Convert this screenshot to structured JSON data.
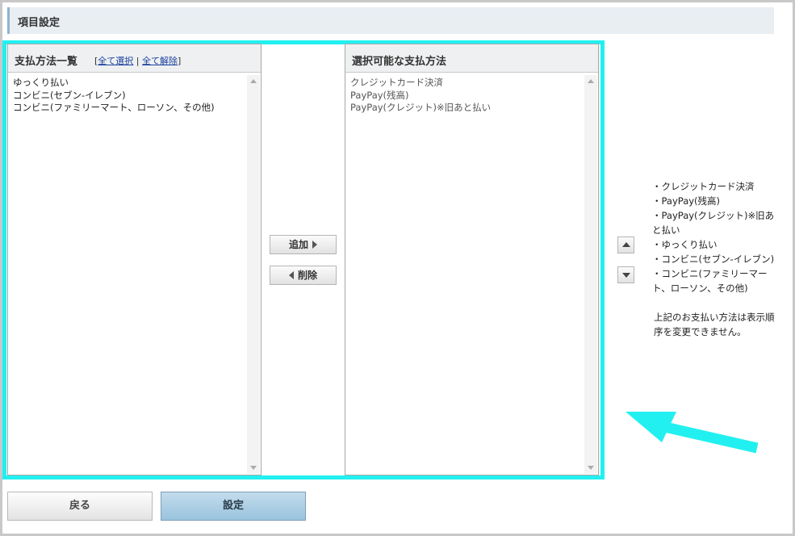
{
  "header": {
    "title": "項目設定"
  },
  "left_panel": {
    "title": "支払方法一覧",
    "bracket_open": "[",
    "select_all": "全て選択",
    "separator": "|",
    "deselect_all": "全て解除",
    "bracket_close": "]",
    "items": [
      "ゆっくり払い",
      "コンビニ(セブン-イレブン)",
      "コンビニ(ファミリーマート、ローソン、その他)"
    ]
  },
  "right_panel": {
    "title": "選択可能な支払方法",
    "items": [
      "クレジットカード決済",
      "PayPay(残高)",
      "PayPay(クレジット)※旧あと払い"
    ]
  },
  "buttons": {
    "add": "追加",
    "delete": "削除",
    "back": "戻る",
    "submit": "設定"
  },
  "order_list": [
    "・クレジットカード決済",
    "・PayPay(残高)",
    "・PayPay(クレジット)※旧あと払い",
    "・ゆっくり払い",
    "・コンビニ(セブン-イレブン)",
    "・コンビニ(ファミリーマート、ローソン、その他)"
  ],
  "note": "上記のお支払い方法は表示順序を変更できません。",
  "colors": {
    "highlight": "#22f0f0",
    "arrow": "#22f0f0",
    "submit_button": "#a8cde4"
  },
  "icons": {
    "up": "triangle-up-icon",
    "down": "triangle-down-icon",
    "add_arrow": "triangle-right-icon",
    "delete_arrow": "triangle-left-icon"
  }
}
